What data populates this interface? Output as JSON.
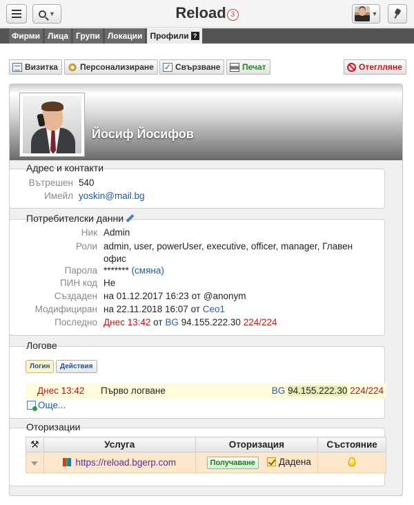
{
  "topbar": {
    "title": "Reload",
    "badge": "3",
    "icons": {
      "menu": "hamburger-icon",
      "search": "search-icon",
      "user": "user-avatar",
      "pin": "pin-icon"
    }
  },
  "tabs": [
    {
      "label": "Фирми",
      "active": false
    },
    {
      "label": "Лица",
      "active": false
    },
    {
      "label": "Групи",
      "active": false
    },
    {
      "label": "Локации",
      "active": false
    },
    {
      "label": "Профили",
      "active": true,
      "help": "?"
    }
  ],
  "toolbar": {
    "card": "Визитка",
    "personalize": "Персонализиране",
    "link": "Свързване",
    "print": "Печат",
    "cancel": "Отеглляне"
  },
  "profile": {
    "name": "Йосиф Йосифов"
  },
  "contacts": {
    "title": "Адрес и контакти",
    "internal_label": "Вътрешен",
    "internal_value": "540",
    "email_label": "Имейл",
    "email_value": "yoskin@mail.bg"
  },
  "user_data": {
    "title": "Потребителски данни",
    "nick_label": "Ник",
    "nick_value": "Admin",
    "roles_label": "Роли",
    "roles_value": "admin, user, powerUser, executive, officer, manager, Главен офис",
    "password_label": "Парола",
    "password_value": "*******",
    "password_change": "(смяна)",
    "pin_label": "ПИН код",
    "pin_value": "Не",
    "created_label": "Създаден",
    "created_prefix": "на 01.12.2017 16:23 от",
    "created_by": "@anonym",
    "modified_label": "Модифициран",
    "modified_prefix": "на 22.11.2018 16:07 от",
    "modified_by": "Ceo1",
    "last_label": "Последно",
    "last_time": "Днес 13:42",
    "last_from": "от",
    "last_country": "BG",
    "last_ip": "94.155.222.30",
    "last_count": "224/224"
  },
  "logs": {
    "title": "Логове",
    "filter_login": "Логин",
    "filter_actions": "Действия",
    "entry_time": "Днес 13:42",
    "entry_text": "Първо логване",
    "entry_country": "BG",
    "entry_ip": "94.155.222.30",
    "entry_count": "224/224",
    "more": "Още..."
  },
  "authorizations": {
    "title": "Оторизации",
    "headers": {
      "tools": "⚒",
      "service": "Услуга",
      "authorization": "Оторизация",
      "state": "Състояние"
    },
    "row": {
      "service": "https://reload.bgerp.com",
      "action_button": "Получаване",
      "authorization": "Дадена"
    }
  },
  "colors": {
    "accent_red": "#c01818",
    "link_blue": "#1e5aa8",
    "tab_bar": "#545454"
  }
}
